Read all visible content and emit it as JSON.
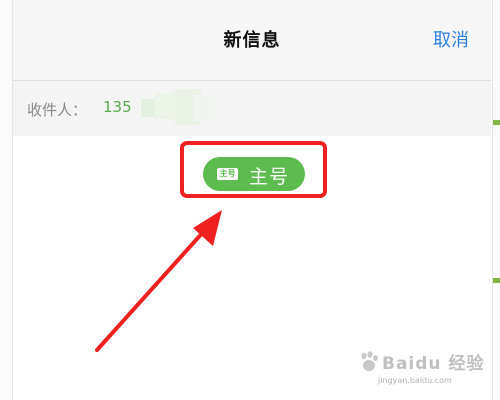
{
  "header": {
    "title": "新信息",
    "cancel_label": "取消"
  },
  "recipient": {
    "label": "收件人：",
    "value": "135"
  },
  "sim_chip": {
    "badge": "主号",
    "label": "主号"
  },
  "watermark": {
    "brand": "Baidu 经验",
    "url": "jingyan.baidu.com"
  },
  "colors": {
    "accent_blue": "#2b7fe0",
    "chip_green": "#5dbb4f",
    "recipient_green": "#5aab4f",
    "highlight_red": "#ee2020"
  }
}
